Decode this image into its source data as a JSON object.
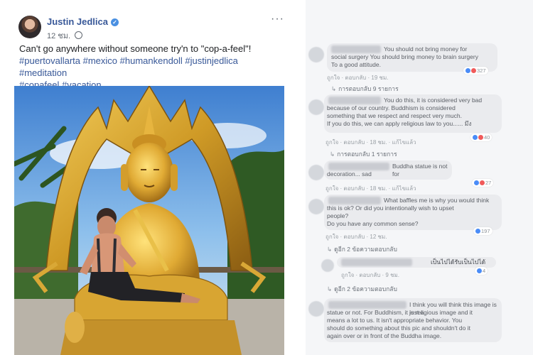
{
  "post": {
    "author": "Justin Jedlica",
    "verified_mark": "✓",
    "time": "12 ชม.",
    "more": "···",
    "caption_line": "Can't go anywhere without someone try'n to \"cop-a-feel\"!",
    "hashtags_line1": "#puertovallarta #mexico #humankendoll #justinjedlica #meditation",
    "hashtags_line2": "#copafeel #vacation"
  },
  "comments": [
    {
      "lines": [
        "You should not bring money for",
        "social surgery You should bring money to brain surgery",
        "To a good attitude."
      ],
      "actions": "ถูกใจ · ตอบกลับ · 19 ชม.",
      "reacts": "327",
      "replies": "การตอบกลับ 9 รายการ"
    },
    {
      "lines": [
        "You do this, it is considered very bad",
        "because of our country. Buddhism is considered",
        "something that we respect and respect very much.",
        "If you do this, we can apply religious law to you...... มึง"
      ],
      "actions": "ถูกใจ · ตอบกลับ · 18 ชม. · แก้ไขแล้ว",
      "reacts": "40",
      "replies": "การตอบกลับ 1 รายการ"
    },
    {
      "lines": [
        "Buddha statue is not for",
        "decoration... sad"
      ],
      "actions": "ถูกใจ · ตอบกลับ · 18 ชม. · แก้ไขแล้ว",
      "reacts": "27"
    },
    {
      "lines": [
        "What baffles me is why you would think",
        "this is ok? Or did you intentionally wish to upset",
        "people?",
        "Do you have any common sense?"
      ],
      "actions": "ถูกใจ · ตอบกลับ · 12 ชม.",
      "reacts": "197",
      "replies": "ดูอีก 2 ข้อความตอบกลับ"
    },
    {
      "lines": [
        "เป็นไปได้รับเป็นไปได้"
      ],
      "actions": "ถูกใจ · ตอบกลับ · 9 ชม.",
      "reacts": "4",
      "replies": "ดูอีก 2 ข้อความตอบกลับ"
    },
    {
      "lines": [
        "I think you will think this image is just a",
        "statue or not. For Buddhism, it is religious image and it",
        "means a lot to us. It isn't appropriate behavior. You",
        "should do something about this pic and shouldn't do it",
        "again over or in front of the Buddha image."
      ]
    }
  ]
}
